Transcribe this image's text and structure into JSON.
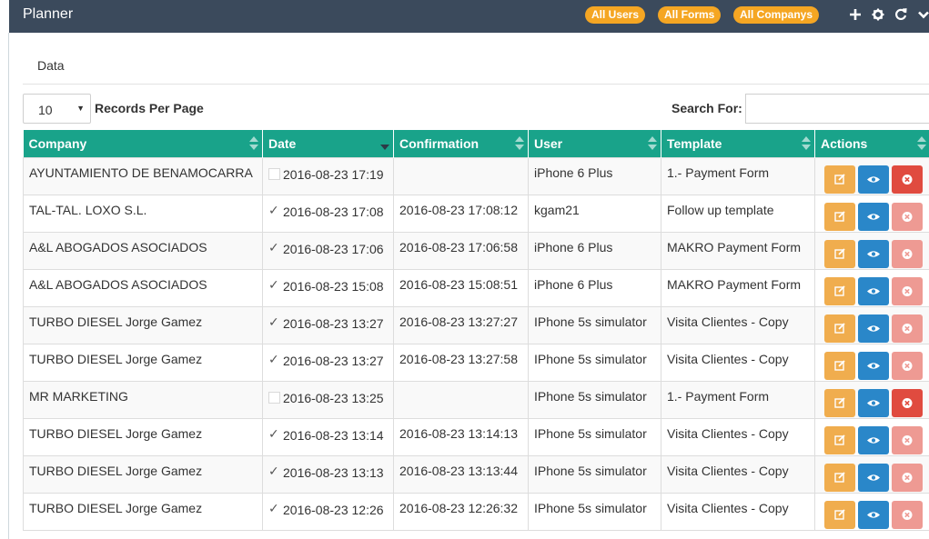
{
  "app": {
    "title": "Planner"
  },
  "header": {
    "filters": [
      "All Users",
      "All Forms",
      "All Companys"
    ],
    "icons": [
      "plus-icon",
      "gear-icon",
      "refresh-icon",
      "chevron-down-icon"
    ]
  },
  "tabs": [
    {
      "label": "Data"
    }
  ],
  "controls": {
    "per_page_value": "10",
    "per_page_label": "Records Per Page",
    "search_label": "Search For:",
    "search_value": ""
  },
  "table": {
    "columns": [
      "Company",
      "Date",
      "Confirmation",
      "User",
      "Template",
      "Actions"
    ],
    "sorted_column": "Date",
    "sort_direction": "desc",
    "rows": [
      {
        "company": "AYUNTAMIENTO DE BENAMOCARRA",
        "confirmed": false,
        "date": "2016-08-23 17:19",
        "confirmation": "",
        "user": "iPhone 6 Plus",
        "template": "1.- Payment Form",
        "delete_enabled": true
      },
      {
        "company": "TAL-TAL. LOXO S.L.",
        "confirmed": true,
        "date": "2016-08-23 17:08",
        "confirmation": "2016-08-23 17:08:12",
        "user": "kgam21",
        "template": "Follow up template",
        "delete_enabled": false
      },
      {
        "company": "A&L ABOGADOS ASOCIADOS",
        "confirmed": true,
        "date": "2016-08-23 17:06",
        "confirmation": "2016-08-23 17:06:58",
        "user": "iPhone 6 Plus",
        "template": "MAKRO Payment Form",
        "delete_enabled": false
      },
      {
        "company": "A&L ABOGADOS ASOCIADOS",
        "confirmed": true,
        "date": "2016-08-23 15:08",
        "confirmation": "2016-08-23 15:08:51",
        "user": "iPhone 6 Plus",
        "template": "MAKRO Payment Form",
        "delete_enabled": false
      },
      {
        "company": "TURBO DIESEL Jorge Gamez",
        "confirmed": true,
        "date": "2016-08-23 13:27",
        "confirmation": "2016-08-23 13:27:27",
        "user": "IPhone 5s simulator",
        "template": "Visita Clientes - Copy",
        "delete_enabled": false
      },
      {
        "company": "TURBO DIESEL Jorge Gamez",
        "confirmed": true,
        "date": "2016-08-23 13:27",
        "confirmation": "2016-08-23 13:27:58",
        "user": "IPhone 5s simulator",
        "template": "Visita Clientes - Copy",
        "delete_enabled": false
      },
      {
        "company": "MR MARKETING",
        "confirmed": false,
        "date": "2016-08-23 13:25",
        "confirmation": "",
        "user": "IPhone 5s simulator",
        "template": "1.- Payment Form",
        "delete_enabled": true
      },
      {
        "company": "TURBO DIESEL Jorge Gamez",
        "confirmed": true,
        "date": "2016-08-23 13:14",
        "confirmation": "2016-08-23 13:14:13",
        "user": "IPhone 5s simulator",
        "template": "Visita Clientes - Copy",
        "delete_enabled": false
      },
      {
        "company": "TURBO DIESEL Jorge Gamez",
        "confirmed": true,
        "date": "2016-08-23 13:13",
        "confirmation": "2016-08-23 13:13:44",
        "user": "IPhone 5s simulator",
        "template": "Visita Clientes - Copy",
        "delete_enabled": false
      },
      {
        "company": "TURBO DIESEL Jorge Gamez",
        "confirmed": true,
        "date": "2016-08-23 12:26",
        "confirmation": "2016-08-23 12:26:32",
        "user": "IPhone 5s simulator",
        "template": "Visita Clientes - Copy",
        "delete_enabled": false
      }
    ]
  },
  "colors": {
    "topbar": "#3b4a5c",
    "pill": "#f5a623",
    "table_header": "#19a38a",
    "edit": "#f0ad4e",
    "view": "#2a87c9",
    "delete": "#e04b3f",
    "delete_disabled": "#ee9a93"
  }
}
